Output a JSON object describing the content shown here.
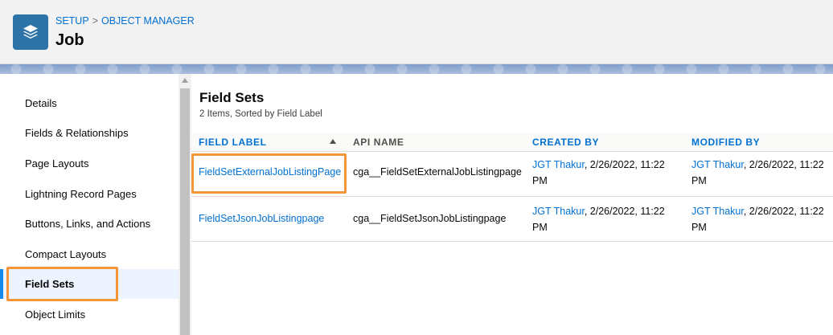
{
  "header": {
    "icon": "layers-icon",
    "breadcrumb": {
      "setup": "SETUP",
      "separator": ">",
      "object_manager": "OBJECT MANAGER"
    },
    "title": "Job"
  },
  "sidebar": {
    "items": [
      {
        "label": "Details"
      },
      {
        "label": "Fields & Relationships"
      },
      {
        "label": "Page Layouts"
      },
      {
        "label": "Lightning Record Pages"
      },
      {
        "label": "Buttons, Links, and Actions"
      },
      {
        "label": "Compact Layouts"
      },
      {
        "label": "Field Sets",
        "active": true
      },
      {
        "label": "Object Limits"
      }
    ]
  },
  "main": {
    "title": "Field Sets",
    "subtitle": "2 Items, Sorted by Field Label",
    "columns": {
      "field_label": "FIELD LABEL",
      "api_name": "API NAME",
      "created_by": "CREATED BY",
      "modified_by": "MODIFIED BY"
    },
    "rows": [
      {
        "field_label": "FieldSetExternalJobListingPage",
        "api_name": "cga__FieldSetExternalJobListingpage",
        "created_user": "JGT Thakur",
        "created_date": ", 2/26/2022, 11:22",
        "created_time": "PM",
        "modified_user": "JGT Thakur",
        "modified_date": ", 2/26/2022, 11:22",
        "modified_time": "PM"
      },
      {
        "field_label": "FieldSetJsonJobListingpage",
        "api_name": "cga__FieldSetJsonJobListingpage",
        "created_user": "JGT Thakur",
        "created_date": ", 2/26/2022, 11:22",
        "created_time": "PM",
        "modified_user": "JGT Thakur",
        "modified_date": ", 2/26/2022, 11:22",
        "modified_time": "PM"
      }
    ]
  },
  "colors": {
    "link": "#0070d2",
    "highlight": "#f39538",
    "active_bar": "#1589ee",
    "icon_bg": "#2e73a8"
  }
}
